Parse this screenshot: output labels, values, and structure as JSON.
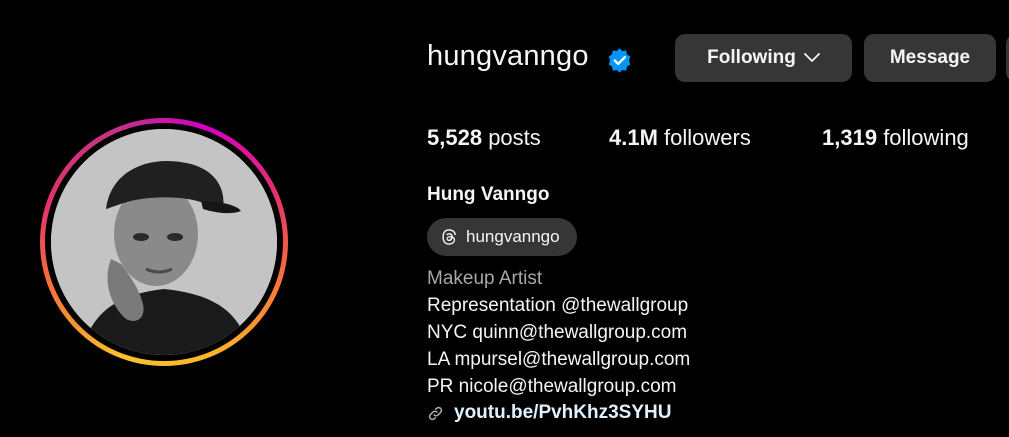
{
  "profile": {
    "username": "hungvanngo",
    "full_name": "Hung Vanngo",
    "threads_handle": "hungvanngo",
    "category": "Makeup Artist",
    "bio_lines": [
      "Representation @thewallgroup",
      "NYC quinn@thewallgroup.com",
      "LA mpursel@thewallgroup.com",
      "PR nicole@thewallgroup.com"
    ],
    "link": "youtu.be/PvhKhz3SYHU"
  },
  "actions": {
    "following_label": "Following",
    "message_label": "Message"
  },
  "stats": {
    "posts_count": "5,528",
    "posts_label": "posts",
    "followers_count": "4.1M",
    "followers_label": "followers",
    "following_count": "1,319",
    "following_label": "following"
  },
  "colors": {
    "background": "#000000",
    "button_bg": "#363636",
    "verified_blue": "#0095f6",
    "secondary_text": "#a8a8a8",
    "link_text": "#e0f1ff"
  },
  "icons": [
    "verified-badge-icon",
    "chevron-down-icon",
    "threads-icon",
    "link-icon"
  ]
}
